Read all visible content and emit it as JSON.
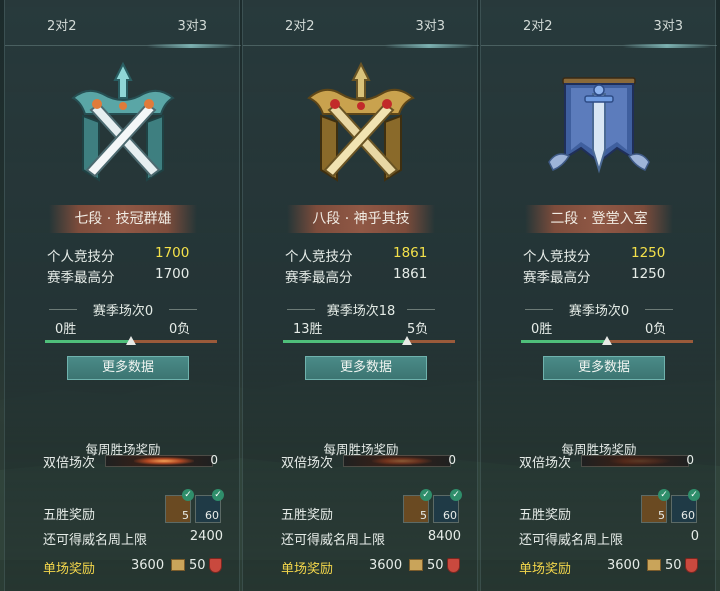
{
  "tabs": {
    "left": "2对2",
    "right": "3对3"
  },
  "labels": {
    "personal_score": "个人竞技分",
    "season_best": "赛季最高分",
    "more_data": "更多数据",
    "weekly_reward": "每周胜场奖励",
    "double_games": "双倍场次",
    "five_win_reward": "五胜奖励",
    "weekly_fame_cap": "还可得威名周上限",
    "single_reward": "单场奖励"
  },
  "panels": [
    {
      "rank": "七段 · 技冠群雄",
      "emblem": "teal-crossed-swords-emblem",
      "personal_score": "1700",
      "season_best": "1700",
      "season_games": "赛季场次0",
      "wins": "0胜",
      "losses": "0负",
      "win_ratio": 0.5,
      "double_count": "0",
      "reward_counts": [
        "5",
        "60"
      ],
      "fame_cap": "2400",
      "gold": "3600",
      "fame": "50"
    },
    {
      "rank": "八段 · 神乎其技",
      "emblem": "gold-crossed-swords-emblem",
      "personal_score": "1861",
      "season_best": "1861",
      "season_games": "赛季场次18",
      "wins": "13胜",
      "losses": "5负",
      "win_ratio": 0.72,
      "double_count": "0",
      "reward_counts": [
        "5",
        "60"
      ],
      "fame_cap": "8400",
      "gold": "3600",
      "fame": "50"
    },
    {
      "rank": "二段 · 登堂入室",
      "emblem": "blue-banner-sword-emblem",
      "personal_score": "1250",
      "season_best": "1250",
      "season_games": "赛季场次0",
      "wins": "0胜",
      "losses": "0负",
      "win_ratio": 0.5,
      "double_count": "0",
      "reward_counts": [
        "5",
        "60"
      ],
      "fame_cap": "0",
      "gold": "3600",
      "fame": "50"
    }
  ],
  "colors": {
    "score_highlight": "#f4e14a",
    "win_bar": "#4fbf7a",
    "loss_bar": "#9a5a3a",
    "button": "#3c7572",
    "single_reward_label": "#f3d64b"
  }
}
